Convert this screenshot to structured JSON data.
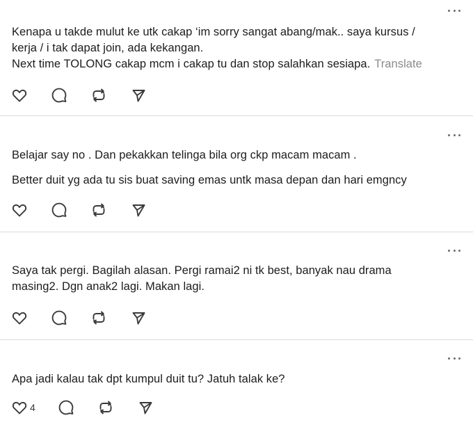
{
  "posts": [
    {
      "lines": [
        "Kenapa u takde mulut ke utk cakap ‘im sorry sangat abang/mak.. saya kursus /",
        "kerja / i tak dapat join, ada kekangan.",
        "Next time TOLONG cakap mcm i cakap tu dan stop salahkan sesiapa."
      ],
      "translate_label": "Translate",
      "like_count": ""
    },
    {
      "lines": [
        "Belajar say no . Dan pekakkan telinga bila org ckp macam macam .",
        "Better duit yg ada tu sis buat saving emas untk masa depan dan hari emgncy"
      ],
      "like_count": ""
    },
    {
      "lines": [
        "Saya tak pergi. Bagilah alasan. Pergi ramai2 ni tk best, banyak nau drama",
        "masing2. Dgn anak2 lagi. Makan lagi."
      ],
      "like_count": ""
    },
    {
      "lines": [
        "Apa jadi kalau tak dpt kumpul duit tu? Jatuh talak ke?"
      ],
      "like_count": "4"
    }
  ],
  "icons": {
    "more": "more-options-icon",
    "like": "heart-icon",
    "reply": "reply-bubble-icon",
    "repost": "repost-icon",
    "share": "share-icon"
  },
  "colors": {
    "text": "#1c1c1c",
    "muted": "#8a8a8a",
    "icon": "#3a3a3a",
    "divider": "#dadada"
  }
}
